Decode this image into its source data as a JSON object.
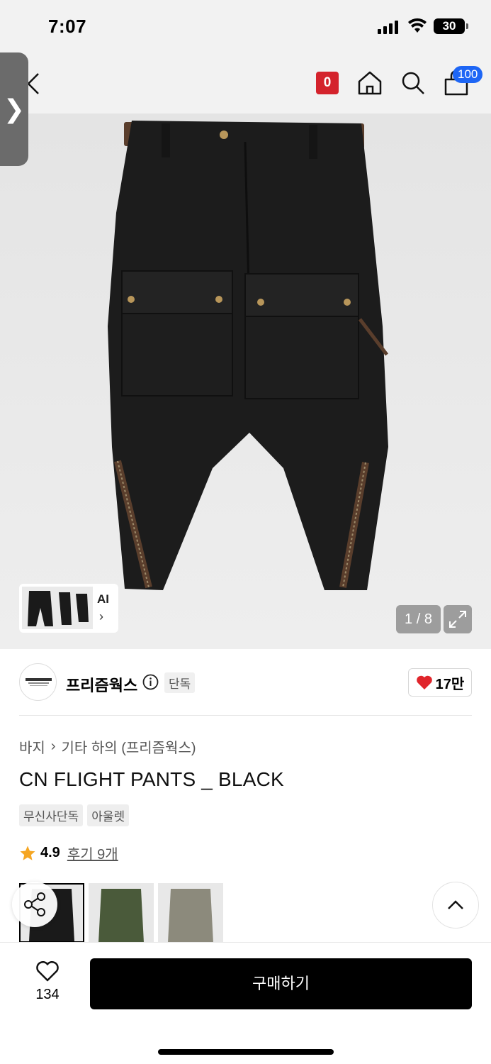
{
  "status_bar": {
    "time": "7:07",
    "battery": "30"
  },
  "nav": {
    "notification_count": "0",
    "cart_count": "100"
  },
  "colors": {
    "accent_red": "#d4232c",
    "cart_badge_blue": "#1e66f5",
    "heart_red": "#e0252b",
    "star": "#f5a623"
  },
  "hero": {
    "ai_label": "AI",
    "ai_arrow": "›",
    "page_indicator": "1 / 8",
    "side_tab_arrow": "❯"
  },
  "brand": {
    "name": "프리즘웍스",
    "exclusive_tag": "단독",
    "like_count": "17만"
  },
  "breadcrumb": {
    "category": "바지",
    "separator": "›",
    "subcategory": "기타 하의 (프리즘웍스)"
  },
  "product": {
    "title": "CN FLIGHT PANTS _ BLACK",
    "tags": [
      "무신사단독",
      "아울렛"
    ],
    "rating": "4.9",
    "review_label": "후기 9개"
  },
  "color_options": [
    {
      "name": "black",
      "color": "#1a1a1a"
    },
    {
      "name": "olive",
      "color": "#4a5a3a"
    },
    {
      "name": "khaki",
      "color": "#8c8a7c"
    }
  ],
  "bottom_bar": {
    "wish_count": "134",
    "buy_label": "구매하기"
  }
}
